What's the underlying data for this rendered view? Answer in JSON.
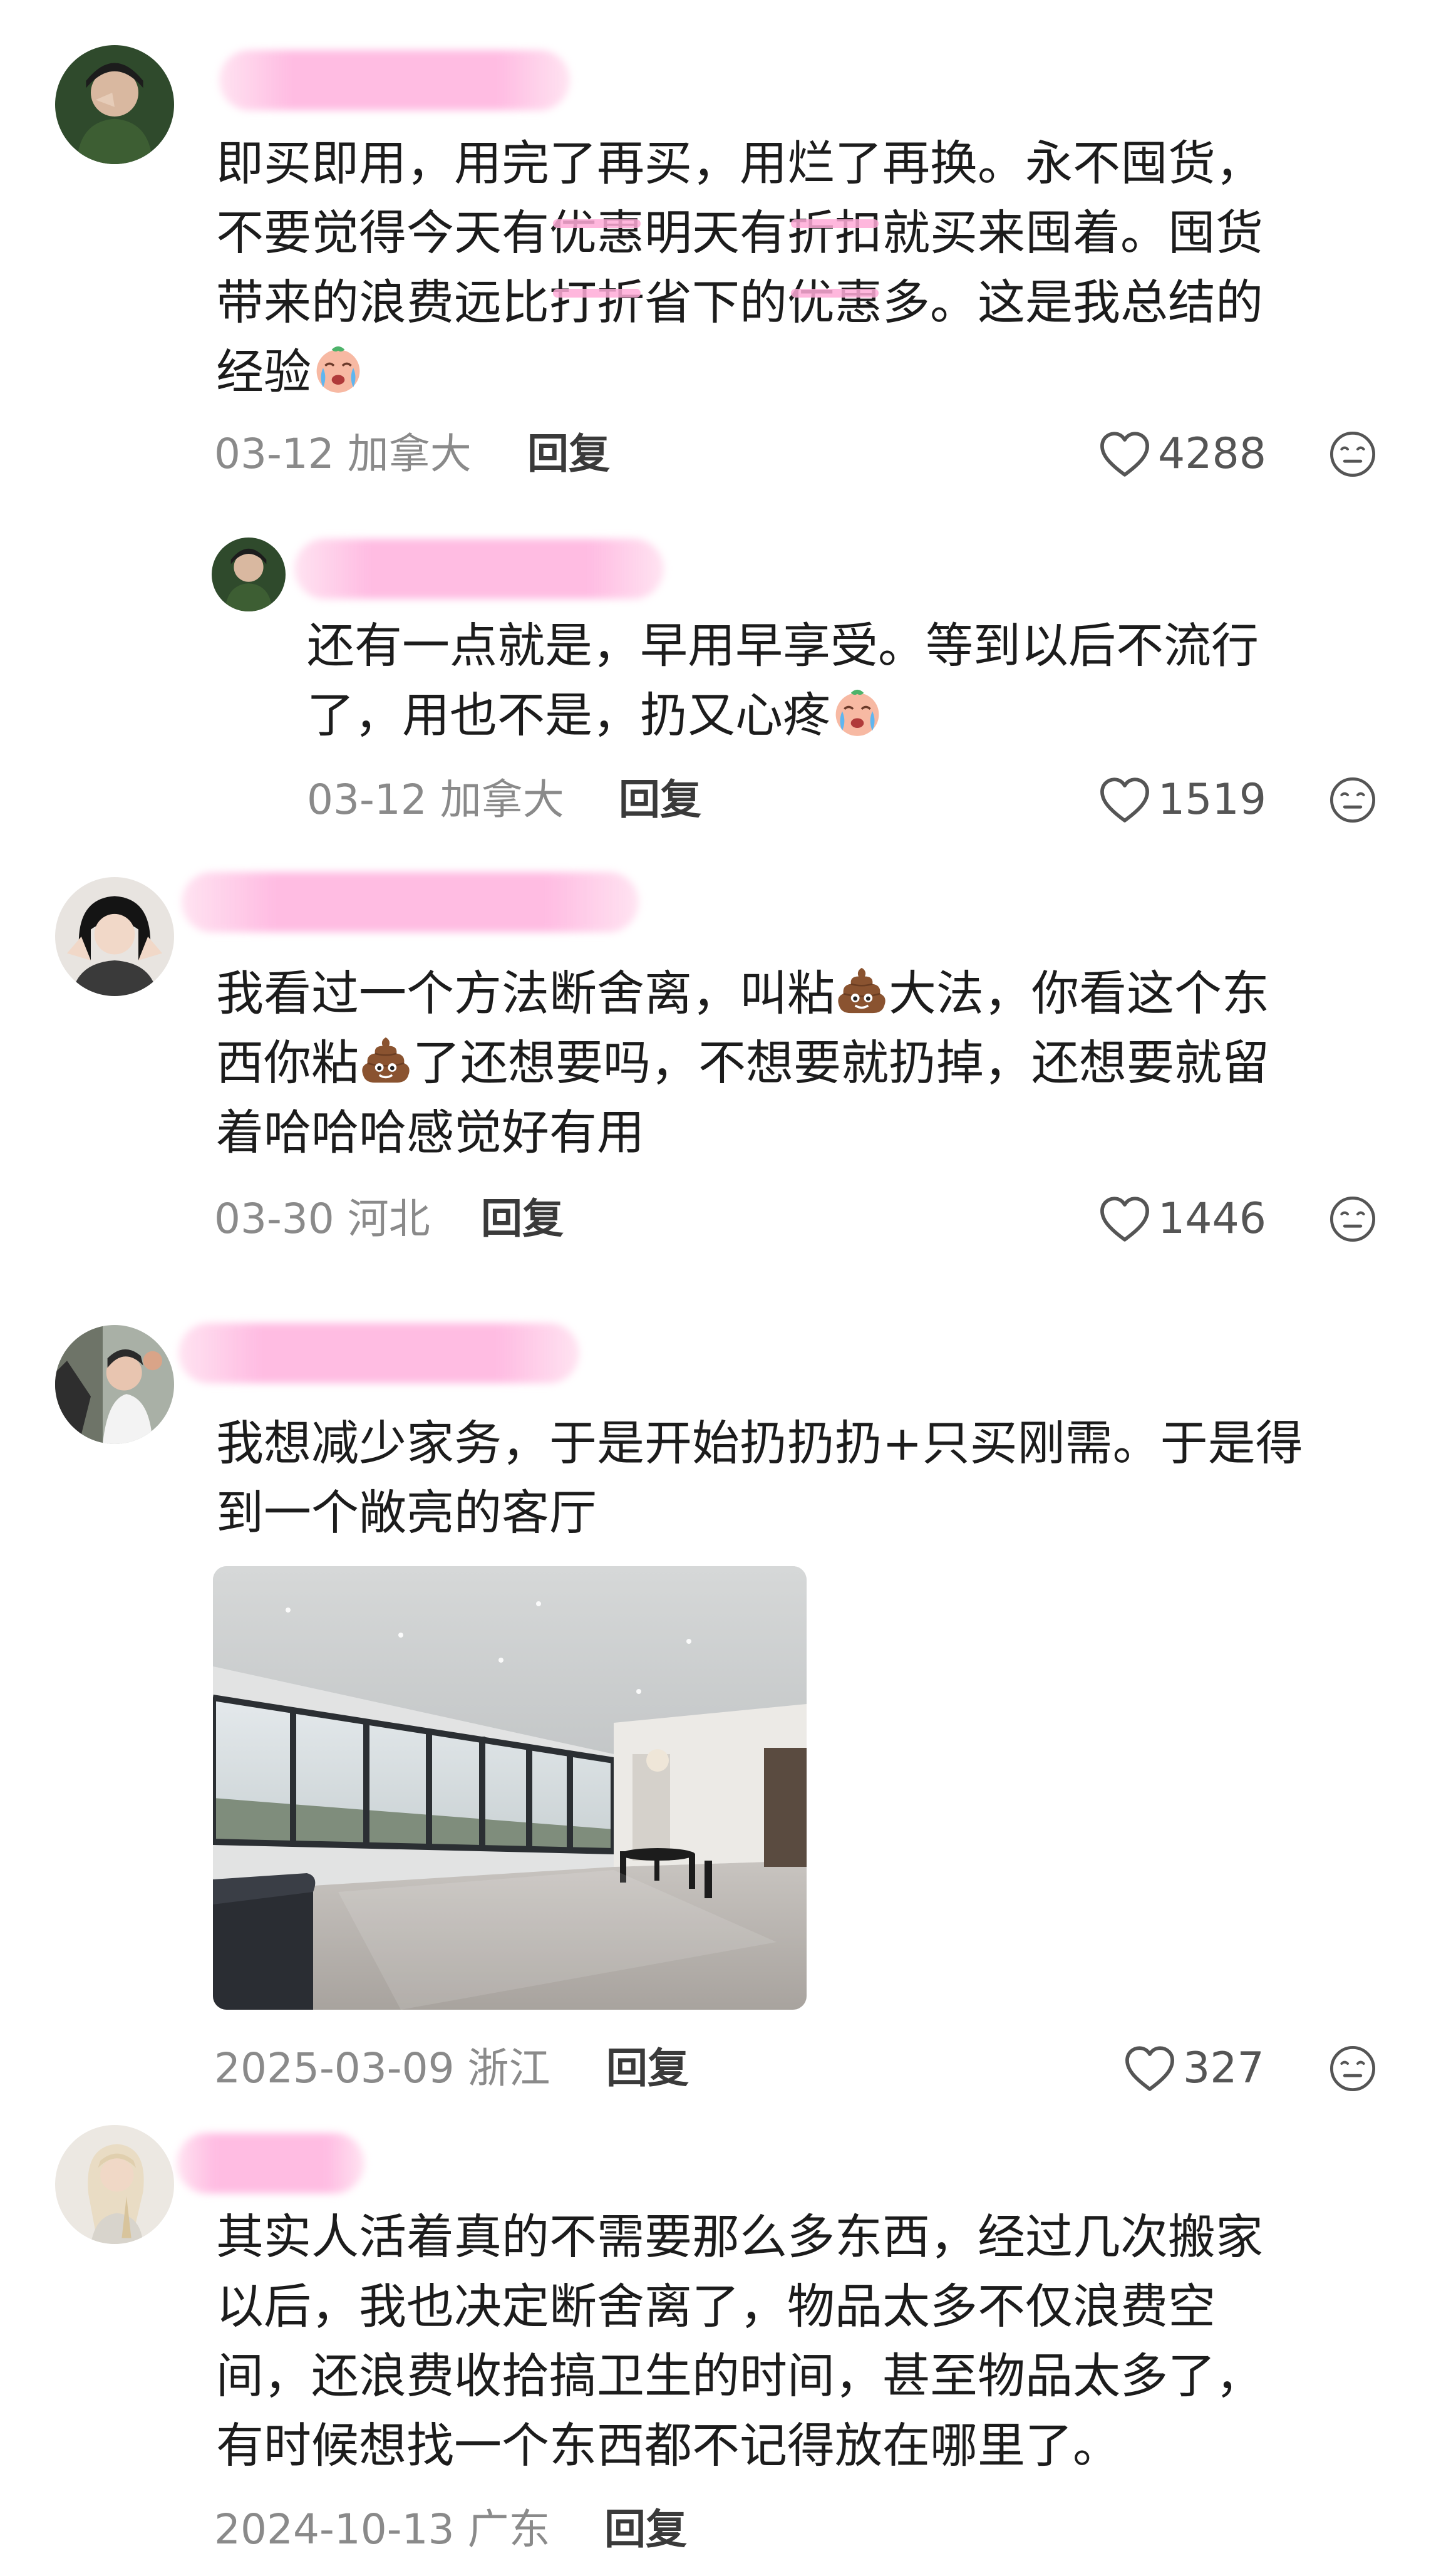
{
  "comments": [
    {
      "id": "c1",
      "lines": [
        [
          "即买即用，用完了再买，用烂了再换。永不囤货，"
        ],
        [
          "不要觉得今天有",
          {
            "s": "优惠"
          },
          "明天有",
          {
            "s": "折扣"
          },
          "就买来囤着。囤货"
        ],
        [
          "带来的浪费远比",
          {
            "s": "打折"
          },
          "省下的",
          {
            "s": "优惠"
          },
          "多。这是我总结的"
        ],
        [
          "经验",
          {
            "e": "crying-emoji"
          }
        ]
      ],
      "date": "03-12",
      "location": "加拿大",
      "reply_label": "回复",
      "likes": "4288"
    },
    {
      "id": "c1r1",
      "lines": [
        [
          "还有一点就是，早用早享受。等到以后不流行"
        ],
        [
          "了，用也不是，扔又心疼",
          {
            "e": "crying-emoji"
          }
        ]
      ],
      "date": "03-12",
      "location": "加拿大",
      "reply_label": "回复",
      "likes": "1519"
    },
    {
      "id": "c2",
      "lines": [
        [
          "我看过一个方法断舍离，叫粘",
          {
            "e": "poop-emoji"
          },
          "大法，你看这个东"
        ],
        [
          "西你粘",
          {
            "e": "poop-emoji"
          },
          "了还想要吗，不想要就扔掉，还想要就留"
        ],
        [
          "着哈哈哈感觉好有用"
        ]
      ],
      "date": "03-30",
      "location": "河北",
      "reply_label": "回复",
      "likes": "1446"
    },
    {
      "id": "c3",
      "lines": [
        [
          "我想减少家务，于是开始扔扔扔+只买刚需。于是得"
        ],
        [
          "到一个敞亮的客厅"
        ]
      ],
      "date": "2025-03-09",
      "location": "浙江",
      "reply_label": "回复",
      "likes": "327",
      "photo": "empty-living-room-photo"
    },
    {
      "id": "c4",
      "lines": [
        [
          "其实人活着真的不需要那么多东西，经过几次搬家"
        ],
        [
          "以后，我也决定断舍离了，物品太多不仅浪费空"
        ],
        [
          "间，还浪费收拾搞卫生的时间，甚至物品太多了，"
        ],
        [
          "有时候想找一个东西都不记得放在哪里了。"
        ]
      ],
      "date": "2024-10-13",
      "location": "广东",
      "reply_label": "回复"
    }
  ],
  "icons": {
    "like": "heart-outline-icon",
    "reaction": "meh-face-icon"
  },
  "colors": {
    "text": "#1c1c1c",
    "meta": "#8a8a8a",
    "name_blur": "#ffbfe0",
    "icon": "#555555"
  }
}
